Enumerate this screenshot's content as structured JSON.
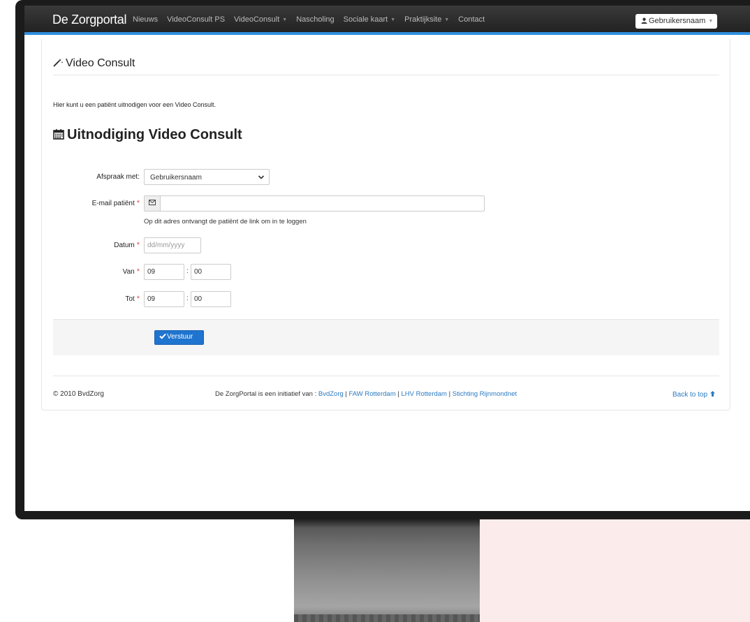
{
  "navbar": {
    "brand": "De Zorgportal",
    "items": [
      {
        "label": "Nieuws",
        "dropdown": false
      },
      {
        "label": "VideoConsult PS",
        "dropdown": false
      },
      {
        "label": "VideoConsult",
        "dropdown": true
      },
      {
        "label": "Nascholing",
        "dropdown": false
      },
      {
        "label": "Sociale kaart",
        "dropdown": true
      },
      {
        "label": "Praktijksite",
        "dropdown": true
      },
      {
        "label": "Contact",
        "dropdown": false
      }
    ],
    "user_icon": "user-icon",
    "user_label": "Gebruikersnaam",
    "accent_color": "#2f8fdf"
  },
  "page": {
    "title_icon": "magic-wand-icon",
    "title": "Video Consult",
    "intro": "Hier kunt u een patiënt uitnodigen voor een Video Consult.",
    "section_icon": "calendar-icon",
    "section_title": "Uitnodiging Video Consult"
  },
  "form": {
    "afspraak_label": "Afspraak met:",
    "afspraak_value": "Gebruikersnaam",
    "email_label": "E-mail patiënt",
    "email_icon": "envelope-icon",
    "email_value": "",
    "email_help": "Op dit adres ontvangt de patiënt de link om in te loggen",
    "datum_label": "Datum",
    "datum_placeholder": "dd/mm/yyyy",
    "van_label": "Van",
    "van_hour": "09",
    "van_minute": "00",
    "tot_label": "Tot",
    "tot_hour": "09",
    "tot_minute": "00",
    "required_mark": "*",
    "time_separator": ":",
    "submit_label": "Verstuur",
    "submit_icon": "check-icon",
    "submit_color": "#1f74cf"
  },
  "footer": {
    "copyright": "© 2010 BvdZorg",
    "credits_prefix": "De ZorgPortal is een initiatief van :",
    "links": [
      "BvdZorg",
      "FAW Rotterdam",
      "LHV Rotterdam",
      "Stichting Rijnmondnet"
    ],
    "separator": "|",
    "back_to_top": "Back to top"
  }
}
